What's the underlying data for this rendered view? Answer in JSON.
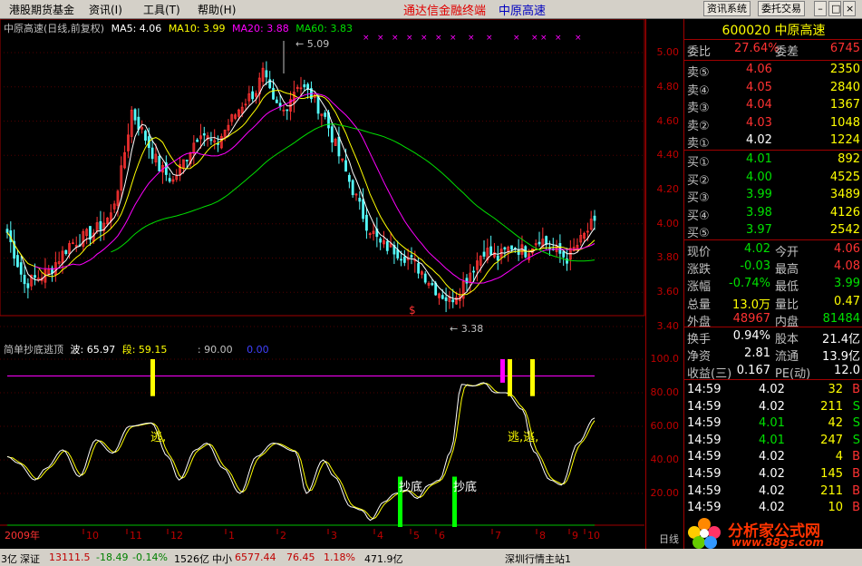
{
  "menu": {
    "items": [
      "港股期货基金",
      "资讯(I)",
      "工具(T)",
      "帮助(H)"
    ],
    "title": "通达信金融终端",
    "stock_title": "中原高速",
    "btn_info": "资讯系统",
    "btn_trade": "委托交易"
  },
  "main_legend": {
    "name": "中原高速(日线,前复权)",
    "ma5": "MA5: 4.06",
    "ma10": "MA10: 3.99",
    "ma20": "MA20: 3.88",
    "ma60": "MA60: 3.83"
  },
  "sub_legend": {
    "name": "简单抄底逃顶",
    "wave": "波: 65.97",
    "seg": "段: 59.15",
    "level": ": 90.00",
    "zero": "0.00"
  },
  "annotations": {
    "high": "5.09",
    "low": "3.38",
    "dollar": "$",
    "escape1": "逃,",
    "escape2": "逃,逃,",
    "bottom1": "抄底",
    "bottom2": "抄底"
  },
  "y_axis_main": [
    "5.00",
    "4.80",
    "4.60",
    "4.40",
    "4.20",
    "4.00",
    "3.80",
    "3.60",
    "3.40"
  ],
  "y_axis_sub": [
    "100.0",
    "80.00",
    "60.00",
    "40.00",
    "20.00"
  ],
  "x_axis": [
    "2009年",
    "10",
    "11",
    "12",
    "1",
    "2",
    "3",
    "4",
    "5",
    "6",
    "7",
    "8",
    "9",
    "10"
  ],
  "period_label": "日线",
  "quote": {
    "code_name": "600020 中原高速",
    "weibi_label": "委比",
    "weibi": "27.64%",
    "weicha_label": "委差",
    "weicha": "6745",
    "asks": [
      {
        "label": "卖⑤",
        "price": "4.06",
        "vol": "2350"
      },
      {
        "label": "卖④",
        "price": "4.05",
        "vol": "2840"
      },
      {
        "label": "卖③",
        "price": "4.04",
        "vol": "1367"
      },
      {
        "label": "卖②",
        "price": "4.03",
        "vol": "1048"
      },
      {
        "label": "卖①",
        "price": "4.02",
        "vol": "1224"
      }
    ],
    "bids": [
      {
        "label": "买①",
        "price": "4.01",
        "vol": "892"
      },
      {
        "label": "买②",
        "price": "4.00",
        "vol": "4525"
      },
      {
        "label": "买③",
        "price": "3.99",
        "vol": "3489"
      },
      {
        "label": "买④",
        "price": "3.98",
        "vol": "4126"
      },
      {
        "label": "买⑤",
        "price": "3.97",
        "vol": "2542"
      }
    ],
    "stats": [
      {
        "l1": "现价",
        "v1": "4.02",
        "l2": "今开",
        "v2": "4.06"
      },
      {
        "l1": "涨跌",
        "v1": "-0.03",
        "l2": "最高",
        "v2": "4.08"
      },
      {
        "l1": "涨幅",
        "v1": "-0.74%",
        "l2": "最低",
        "v2": "3.99"
      },
      {
        "l1": "总量",
        "v1": "13.0万",
        "l2": "量比",
        "v2": "0.47"
      },
      {
        "l1": "外盘",
        "v1": "48967",
        "l2": "内盘",
        "v2": "81484"
      }
    ],
    "stats2": [
      {
        "l1": "换手",
        "v1": "0.94%",
        "l2": "股本",
        "v2": "21.4亿"
      },
      {
        "l1": "净资",
        "v1": "2.81",
        "l2": "流通",
        "v2": "13.9亿"
      },
      {
        "l1": "收益(三)",
        "v1": "0.167",
        "l2": "PE(动)",
        "v2": "12.0"
      }
    ],
    "ticks": [
      {
        "time": "14:59",
        "price": "4.02",
        "vol": "32",
        "bs": "B"
      },
      {
        "time": "14:59",
        "price": "4.02",
        "vol": "211",
        "bs": "S"
      },
      {
        "time": "14:59",
        "price": "4.01",
        "vol": "42",
        "bs": "S"
      },
      {
        "time": "14:59",
        "price": "4.01",
        "vol": "247",
        "bs": "S"
      },
      {
        "time": "14:59",
        "price": "4.02",
        "vol": "4",
        "bs": "B"
      },
      {
        "time": "14:59",
        "price": "4.02",
        "vol": "145",
        "bs": "B"
      },
      {
        "time": "14:59",
        "price": "4.02",
        "vol": "211",
        "bs": "B"
      },
      {
        "time": "14:59",
        "price": "4.02",
        "vol": "10",
        "bs": "B"
      }
    ]
  },
  "watermark": {
    "text": "分析家公式网",
    "url": "www.88gs.com"
  },
  "status": {
    "left": "3亿",
    "sz_label": "深证",
    "sz_val": "13111.5",
    "sz_chg": "-18.49",
    "sz_pct": "-0.14%",
    "sz_amt": "1526亿",
    "zx_label": "中小",
    "zx_val": "6577.44",
    "zx_chg": "76.45",
    "zx_pct": "1.18%",
    "zx_amt": "471.9亿",
    "station": "深圳行情主站1"
  },
  "colors": {
    "up": "#ff3232",
    "down": "#54fcfc",
    "ma5": "#ffffff",
    "ma10": "#ffff00",
    "ma20": "#ff00ff",
    "ma60": "#00e000",
    "signal_top": "#ffff00",
    "signal_bottom": "#00ff00"
  }
}
